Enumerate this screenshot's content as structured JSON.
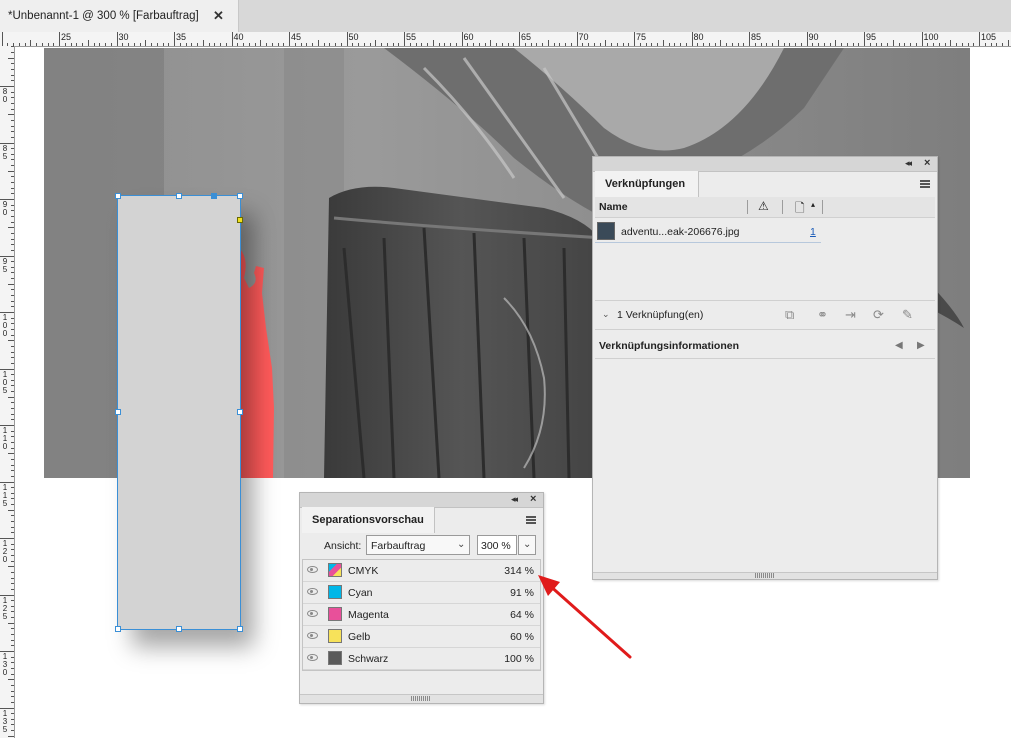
{
  "document_tab": {
    "title": "*Unbenannt-1 @ 300 % [Farbauftrag]",
    "close": "✕"
  },
  "ruler": {
    "horizontal_labels": [
      "25",
      "30",
      "35",
      "40",
      "45",
      "50",
      "55",
      "60",
      "65",
      "70",
      "75",
      "80",
      "85",
      "90",
      "95",
      "100",
      "105"
    ],
    "vertical_labels": [
      "8\n0",
      "8\n5",
      "9\n0",
      "9\n5",
      "1\n0\n0",
      "1\n0\n5",
      "1\n1\n0",
      "1\n1\n5",
      "1\n2\n0",
      "1\n2\n5",
      "1\n3\n0",
      "1\n3\n5"
    ]
  },
  "links_panel": {
    "tab_label": "Verknüpfungen",
    "column_name": "Name",
    "link": {
      "name": "adventu...eak-206676.jpg",
      "page": "1"
    },
    "count_label": "1 Verknüpfung(en)",
    "info_label": "Verknüpfungsinformationen"
  },
  "sep_panel": {
    "tab_label": "Separationsvorschau",
    "view_label": "Ansicht:",
    "view_value": "Farbauftrag",
    "zoom_value": "300 %",
    "rows": [
      {
        "name": "CMYK",
        "percent": "314 %",
        "color": "#8aa0c0"
      },
      {
        "name": "Cyan",
        "percent": "91 %",
        "color": "#00b7e8"
      },
      {
        "name": "Magenta",
        "percent": "64 %",
        "color": "#e8509a"
      },
      {
        "name": "Gelb",
        "percent": "60 %",
        "color": "#f7e25a"
      },
      {
        "name": "Schwarz",
        "percent": "100 %",
        "color": "#5a5a5a"
      }
    ]
  },
  "colors": {
    "selection": "#3a8fd6",
    "overink_highlight": "#ff5a5a",
    "arrow": "#e01b1b"
  }
}
